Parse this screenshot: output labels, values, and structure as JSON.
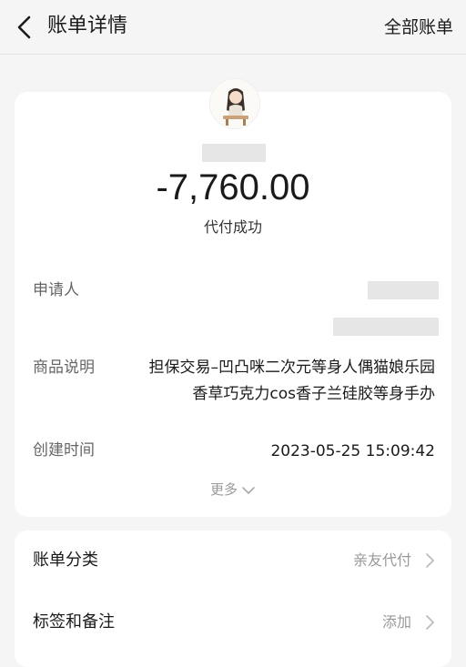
{
  "nav": {
    "title": "账单详情",
    "right_label": "全部账单",
    "back_icon": "chevron-left-icon"
  },
  "summary": {
    "amount": "-7,760.00",
    "status": "代付成功"
  },
  "details": {
    "applicant_label": "申请人",
    "product_label": "商品说明",
    "product_line1": "担保交易–凹凸咪二次元等身人偶猫娘乐园",
    "product_line2": "香草巧克力cos香子兰硅胶等身手办",
    "created_label": "创建时间",
    "created_value": "2023-05-25 15:09:42",
    "more_label": "更多"
  },
  "bottom": {
    "category_label": "账单分类",
    "category_value": "亲友代付",
    "tag_label": "标签和备注",
    "tag_value": "添加"
  },
  "colors": {
    "background": "#f5f5f5",
    "card": "#ffffff",
    "text_primary": "#1a1a1a",
    "text_secondary": "#999999"
  }
}
